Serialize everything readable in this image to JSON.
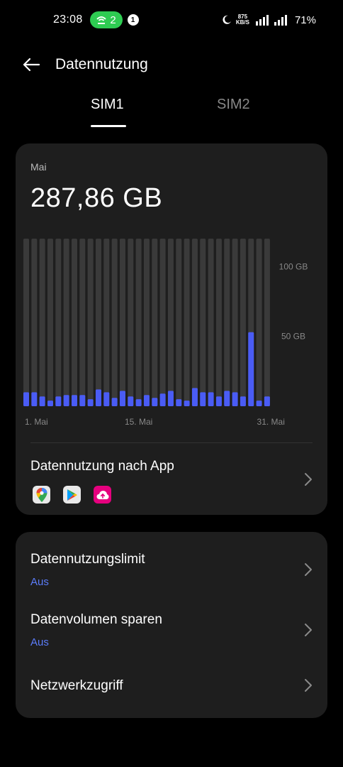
{
  "status_bar": {
    "time": "23:08",
    "hotspot_count": "2",
    "notification_count": "1",
    "net_speed_value": "875",
    "net_speed_unit": "KB/S",
    "battery": "71%"
  },
  "header": {
    "title": "Datennutzung"
  },
  "tabs": [
    {
      "label": "SIM1",
      "selected": true
    },
    {
      "label": "SIM2",
      "selected": false
    }
  ],
  "usage": {
    "period": "Mai",
    "total": "287,86 GB"
  },
  "chart_data": {
    "type": "bar",
    "title": "",
    "xlabel": "",
    "ylabel": "",
    "unit": "GB",
    "ylim": [
      0,
      120
    ],
    "ytick_labels": [
      "100 GB",
      "50 GB"
    ],
    "yticks": [
      100,
      50
    ],
    "xtick_labels": [
      "1. Mai",
      "15. Mai",
      "31. Mai"
    ],
    "xticks": [
      1,
      15,
      31
    ],
    "categories": [
      1,
      2,
      3,
      4,
      5,
      6,
      7,
      8,
      9,
      10,
      11,
      12,
      13,
      14,
      15,
      16,
      17,
      18,
      19,
      20,
      21,
      22,
      23,
      24,
      25,
      26,
      27,
      28,
      29,
      30,
      31
    ],
    "values": [
      10,
      10,
      7,
      4,
      7,
      8,
      8,
      8,
      5,
      12,
      10,
      6,
      11,
      7,
      5,
      8,
      6,
      9,
      11,
      5,
      4,
      13,
      10,
      10,
      7,
      11,
      10,
      7,
      53,
      4,
      7
    ],
    "bar_color": "#4a5cf5",
    "track_color": "#3a3a3a"
  },
  "app_usage": {
    "title": "Datennutzung nach App",
    "apps": [
      {
        "icon": "google-maps-icon",
        "color": "#e9e9e9"
      },
      {
        "icon": "google-play-icon",
        "color": "#e9e9e9"
      },
      {
        "icon": "cloud-upload-icon",
        "color": "#e6007e"
      }
    ]
  },
  "settings": [
    {
      "title": "Datennutzungslimit",
      "value": "Aus"
    },
    {
      "title": "Datenvolumen sparen",
      "value": "Aus"
    },
    {
      "title": "Netzwerkzugriff",
      "value": ""
    }
  ],
  "colors": {
    "accent": "#5b7cf9",
    "background": "#000000",
    "card": "#1e1e1e"
  }
}
